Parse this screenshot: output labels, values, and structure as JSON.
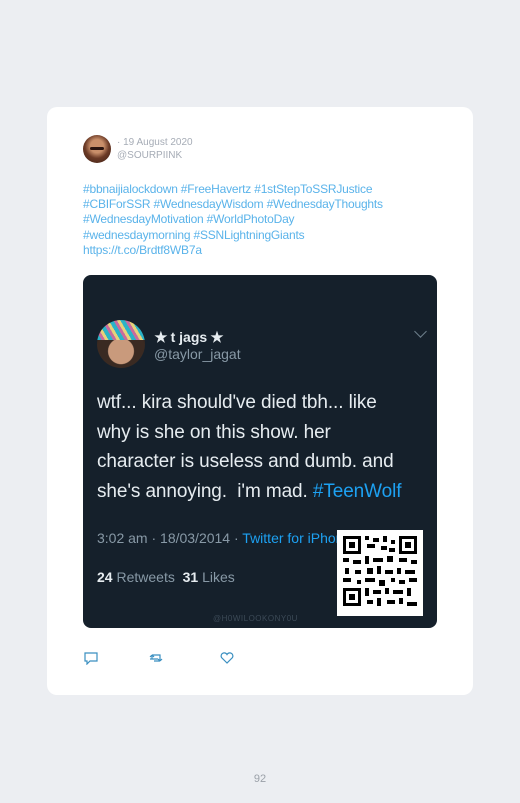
{
  "post": {
    "date": "· 19 August 2020",
    "handle": "@SOURPIINK",
    "hashtag_lines": [
      "#bbnaijialockdown #FreeHavertz #1stStepToSSRJustice",
      "#CBIForSSR #WednesdayWisdom #WednesdayThoughts",
      "#WednesdayMotivation #WorldPhotoDay",
      "#wednesdaymorning #SSNLightningGiants",
      "https://t.co/Brdtf8WB7a"
    ]
  },
  "embedded_tweet": {
    "name": "✭ t jags ✭",
    "handle": "@taylor_jagat",
    "text_line1": "wtf... kira should've died tbh... like",
    "text_line2": "why is she on this show. her",
    "text_line3": "character is useless and dumb. and",
    "text_line4": "she's annoying.  i'm mad. ",
    "text_tag": "#TeenWolf",
    "time": "3:02 am · 18/03/2014 · ",
    "source": "Twitter for iPhone",
    "retweets_count": "24",
    "retweets_label": "Retweets",
    "likes_count": "31",
    "likes_label": "Likes",
    "watermark": "@H0WILOOKONY0U"
  },
  "actions": {
    "reply": "reply-icon",
    "retweet": "retweet-icon",
    "like": "heart-icon"
  },
  "colors": {
    "link": "#5ab3ea",
    "tweet_bg": "#15202b",
    "page_bg": "#eceef2"
  },
  "page_number": "92"
}
